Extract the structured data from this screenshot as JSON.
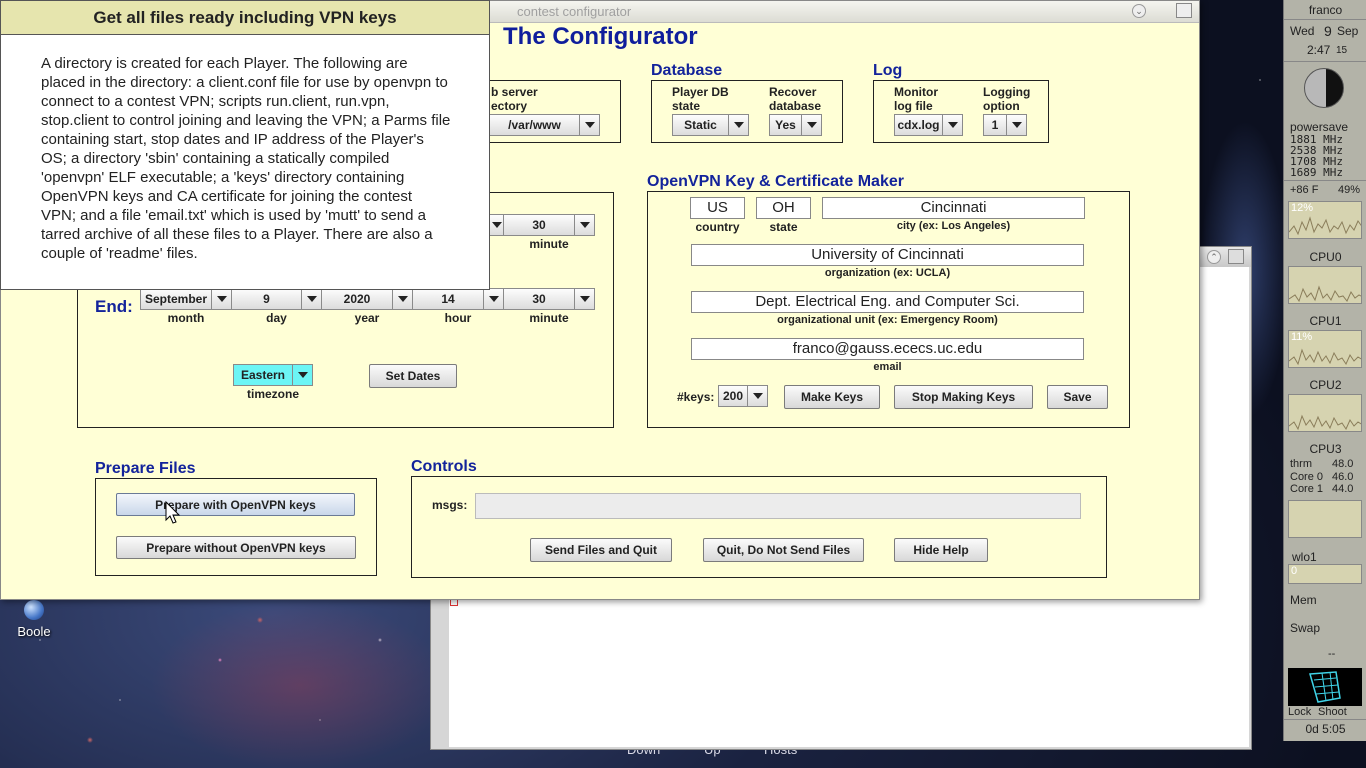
{
  "desktop": {
    "icon_label": "Boole",
    "bottom_labels": [
      "Down",
      "Up",
      "Hosts"
    ]
  },
  "window": {
    "title": "contest configurator"
  },
  "app": {
    "title": "The Configurator"
  },
  "web_server": {
    "label_line1": "b server",
    "label_line2": "ectory",
    "value": "/var/www"
  },
  "database": {
    "title": "Database",
    "player_db_label1": "Player DB",
    "player_db_label2": "state",
    "player_db_value": "Static",
    "recover_label1": "Recover",
    "recover_label2": "database",
    "recover_value": "Yes"
  },
  "log": {
    "title": "Log",
    "monitor_label1": "Monitor",
    "monitor_label2": "log file",
    "monitor_value": "cdx.log",
    "logging_label1": "Logging",
    "logging_label2": "option",
    "logging_value": "1"
  },
  "dates": {
    "start_minute": "30",
    "minute_label": "minute",
    "end_label": "End:",
    "end": {
      "month": "September",
      "day": "9",
      "year": "2020",
      "hour": "14",
      "minute": "30"
    },
    "labels": {
      "month": "month",
      "day": "day",
      "year": "year",
      "hour": "hour",
      "minute": "minute"
    },
    "timezone_value": "Eastern",
    "timezone_label": "timezone",
    "set_dates_button": "Set Dates"
  },
  "openvpn": {
    "title": "OpenVPN Key & Certificate Maker",
    "country_value": "US",
    "country_label": "country",
    "state_value": "OH",
    "state_label": "state",
    "city_value": "Cincinnati",
    "city_label": "city (ex: Los Angeles)",
    "org_value": "University of Cincinnati",
    "org_label": "organization (ex: UCLA)",
    "unit_value": "Dept. Electrical Eng. and Computer Sci.",
    "unit_label": "organizational unit (ex: Emergency Room)",
    "email_value": "franco@gauss.ececs.uc.edu",
    "email_label": "email",
    "keys_label": "#keys:",
    "keys_value": "200",
    "make_keys_button": "Make Keys",
    "stop_keys_button": "Stop Making Keys",
    "save_button": "Save"
  },
  "prepare": {
    "title": "Prepare Files",
    "with_keys_button": "Prepare with OpenVPN keys",
    "without_keys_button": "Prepare without OpenVPN keys"
  },
  "controls": {
    "title": "Controls",
    "msgs_label": "msgs:",
    "msgs_value": "",
    "send_button": "Send Files and Quit",
    "quit_button": "Quit, Do Not Send Files",
    "hide_help_button": "Hide Help"
  },
  "help": {
    "title": "Get all files ready including VPN keys",
    "body": "A directory is created for each Player.  The following are placed in the directory: a client.conf file for use by openvpn to connect to a contest VPN; scripts run.client, run.vpn, stop.client to control joining and leaving the VPN; a Parms file containing start, stop dates and IP address of the Player's OS; a directory 'sbin' containing a statically compiled 'openvpn' ELF executable; a 'keys' directory containing OpenVPN keys and CA certificate for joining the contest VPN; and a file 'email.txt' which is used by 'mutt' to send a tarred archive of all these files to a Player. There are also a couple of 'readme' files."
  },
  "monitor": {
    "user": "franco",
    "day": "Wed",
    "date_num": "9",
    "month": "Sep",
    "time": "2:47",
    "seconds": "15",
    "governor": "powersave",
    "freqs": [
      "1881 MHz",
      "2538 MHz",
      "1708 MHz",
      "1689 MHz"
    ],
    "temp": "+86 F",
    "battery": "49%",
    "cpu_all_pct": "12%",
    "cpu_labels": [
      "CPU0",
      "CPU1",
      "CPU2",
      "CPU3"
    ],
    "cpu1_pct": "11%",
    "thermal": [
      {
        "name": "thrm",
        "value": "48.0"
      },
      {
        "name": "Core 0",
        "value": "46.0"
      },
      {
        "name": "Core 1",
        "value": "44.0"
      }
    ],
    "net_iface": "wlo1",
    "net_value": "0",
    "mem_label": "Mem",
    "swap_label": "Swap",
    "swap_value": "--",
    "lock_label": "Lock",
    "shoot_label": "Shoot",
    "uptime": "0d  5:05"
  }
}
